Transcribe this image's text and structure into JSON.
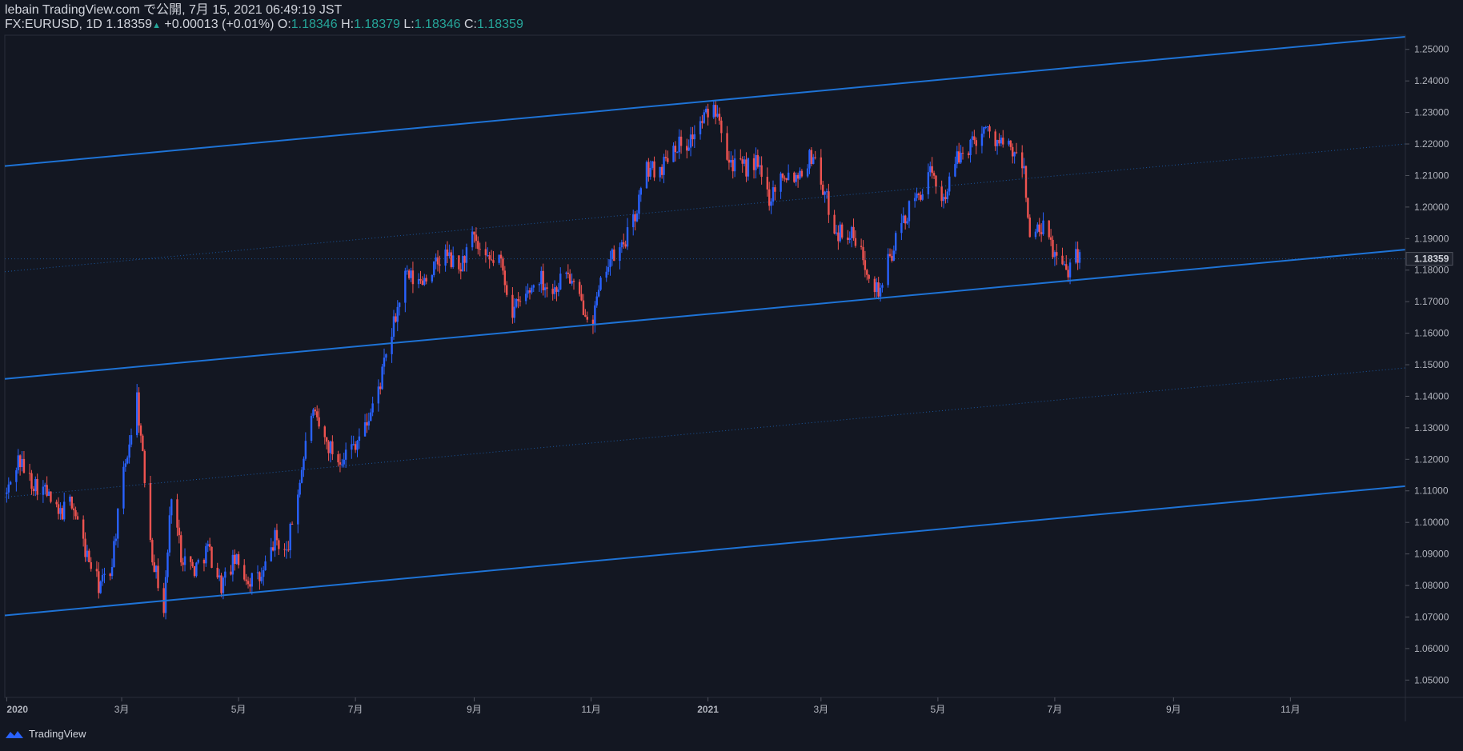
{
  "header": {
    "line1": "lebain TradingView.com で公開, 7月 15, 2021 06:49:19 JST",
    "symbol": "FX:EURUSD, 1D 1.18359",
    "change": "+0.00013 (+0.01%)",
    "o_label": "O:",
    "o_val": "1.18346",
    "h_label": "H:",
    "h_val": "1.18379",
    "l_label": "L:",
    "l_val": "1.18346",
    "c_label": "C:",
    "c_val": "1.18359"
  },
  "footer": {
    "brand": "TradingView"
  },
  "colors": {
    "up": "#2962ff",
    "down": "#ef5350",
    "channel": "#1e73d6",
    "bg": "#131722",
    "grid_text": "#b2b5be"
  },
  "chart_data": {
    "type": "candlestick",
    "symbol": "FX:EURUSD",
    "interval": "1D",
    "last_price": "1.18359",
    "y_ticks": [
      "1.25000",
      "1.24000",
      "1.23000",
      "1.22000",
      "1.21000",
      "1.20000",
      "1.19000",
      "1.18000",
      "1.17000",
      "1.16000",
      "1.15000",
      "1.14000",
      "1.13000",
      "1.12000",
      "1.11000",
      "1.10000",
      "1.09000",
      "1.08000",
      "1.07000",
      "1.06000",
      "1.05000"
    ],
    "ylim": [
      1.0445,
      1.2545
    ],
    "x_ticks": [
      {
        "label": "2020",
        "date": "2020-01-01"
      },
      {
        "label": "3月",
        "date": "2020-03-01"
      },
      {
        "label": "5月",
        "date": "2020-05-01"
      },
      {
        "label": "7月",
        "date": "2020-07-01"
      },
      {
        "label": "9月",
        "date": "2020-09-01"
      },
      {
        "label": "11月",
        "date": "2020-11-01"
      },
      {
        "label": "2021",
        "date": "2021-01-01"
      },
      {
        "label": "3月",
        "date": "2021-03-01"
      },
      {
        "label": "5月",
        "date": "2021-05-01"
      },
      {
        "label": "7月",
        "date": "2021-07-01"
      },
      {
        "label": "9月",
        "date": "2021-09-01"
      },
      {
        "label": "11月",
        "date": "2021-11-01"
      }
    ],
    "xlim": [
      "2019-12-31",
      "2021-12-31"
    ],
    "channel_lines": [
      {
        "style": "solid",
        "start": [
          "2019-12-31",
          1.213
        ],
        "end": [
          "2021-12-31",
          1.254
        ]
      },
      {
        "style": "solid",
        "start": [
          "2019-12-31",
          1.1455
        ],
        "end": [
          "2021-12-31",
          1.1865
        ]
      },
      {
        "style": "solid",
        "start": [
          "2019-12-31",
          1.0705
        ],
        "end": [
          "2021-12-31",
          1.1115
        ]
      },
      {
        "style": "dotted",
        "start": [
          "2019-12-31",
          1.1795
        ],
        "end": [
          "2021-12-31",
          1.22
        ]
      },
      {
        "style": "dotted",
        "start": [
          "2019-12-31",
          1.108
        ],
        "end": [
          "2021-12-31",
          1.149
        ]
      }
    ],
    "close_path": [
      [
        "2020-01-01",
        1.109
      ],
      [
        "2020-01-07",
        1.12
      ],
      [
        "2020-01-14",
        1.113
      ],
      [
        "2020-01-21",
        1.11
      ],
      [
        "2020-01-28",
        1.102
      ],
      [
        "2020-02-04",
        1.107
      ],
      [
        "2020-02-11",
        1.091
      ],
      [
        "2020-02-18",
        1.08
      ],
      [
        "2020-02-24",
        1.084
      ],
      [
        "2020-03-02",
        1.115
      ],
      [
        "2020-03-09",
        1.14
      ],
      [
        "2020-03-12",
        1.12
      ],
      [
        "2020-03-17",
        1.09
      ],
      [
        "2020-03-23",
        1.072
      ],
      [
        "2020-03-27",
        1.11
      ],
      [
        "2020-04-01",
        1.09
      ],
      [
        "2020-04-08",
        1.085
      ],
      [
        "2020-04-15",
        1.092
      ],
      [
        "2020-04-22",
        1.08
      ],
      [
        "2020-04-29",
        1.088
      ],
      [
        "2020-05-06",
        1.082
      ],
      [
        "2020-05-13",
        1.082
      ],
      [
        "2020-05-20",
        1.095
      ],
      [
        "2020-05-26",
        1.09
      ],
      [
        "2020-06-01",
        1.11
      ],
      [
        "2020-06-08",
        1.135
      ],
      [
        "2020-06-15",
        1.126
      ],
      [
        "2020-06-22",
        1.12
      ],
      [
        "2020-06-29",
        1.124
      ],
      [
        "2020-07-06",
        1.13
      ],
      [
        "2020-07-13",
        1.142
      ],
      [
        "2020-07-20",
        1.16
      ],
      [
        "2020-07-27",
        1.178
      ],
      [
        "2020-08-03",
        1.176
      ],
      [
        "2020-08-10",
        1.18
      ],
      [
        "2020-08-17",
        1.185
      ],
      [
        "2020-08-24",
        1.18
      ],
      [
        "2020-08-31",
        1.19
      ],
      [
        "2020-09-07",
        1.182
      ],
      [
        "2020-09-14",
        1.184
      ],
      [
        "2020-09-21",
        1.167
      ],
      [
        "2020-09-28",
        1.172
      ],
      [
        "2020-10-05",
        1.178
      ],
      [
        "2020-10-12",
        1.173
      ],
      [
        "2020-10-19",
        1.18
      ],
      [
        "2020-10-26",
        1.17
      ],
      [
        "2020-11-02",
        1.165
      ],
      [
        "2020-11-09",
        1.182
      ],
      [
        "2020-11-16",
        1.186
      ],
      [
        "2020-11-23",
        1.195
      ],
      [
        "2020-11-30",
        1.212
      ],
      [
        "2020-12-07",
        1.212
      ],
      [
        "2020-12-14",
        1.22
      ],
      [
        "2020-12-21",
        1.22
      ],
      [
        "2021-01-01",
        1.23
      ],
      [
        "2021-01-06",
        1.232
      ],
      [
        "2021-01-12",
        1.215
      ],
      [
        "2021-01-19",
        1.212
      ],
      [
        "2021-01-26",
        1.214
      ],
      [
        "2021-02-02",
        1.203
      ],
      [
        "2021-02-09",
        1.211
      ],
      [
        "2021-02-16",
        1.21
      ],
      [
        "2021-02-25",
        1.217
      ],
      [
        "2021-03-02",
        1.206
      ],
      [
        "2021-03-09",
        1.192
      ],
      [
        "2021-03-16",
        1.192
      ],
      [
        "2021-03-23",
        1.184
      ],
      [
        "2021-03-31",
        1.173
      ],
      [
        "2021-04-06",
        1.184
      ],
      [
        "2021-04-13",
        1.196
      ],
      [
        "2021-04-20",
        1.203
      ],
      [
        "2021-04-27",
        1.21
      ],
      [
        "2021-05-04",
        1.203
      ],
      [
        "2021-05-11",
        1.215
      ],
      [
        "2021-05-18",
        1.22
      ],
      [
        "2021-05-25",
        1.225
      ],
      [
        "2021-06-01",
        1.221
      ],
      [
        "2021-06-08",
        1.218
      ],
      [
        "2021-06-15",
        1.212
      ],
      [
        "2021-06-18",
        1.19
      ],
      [
        "2021-06-25",
        1.193
      ],
      [
        "2021-07-01",
        1.185
      ],
      [
        "2021-07-07",
        1.179
      ],
      [
        "2021-07-12",
        1.187
      ],
      [
        "2021-07-14",
        1.1836
      ]
    ]
  }
}
